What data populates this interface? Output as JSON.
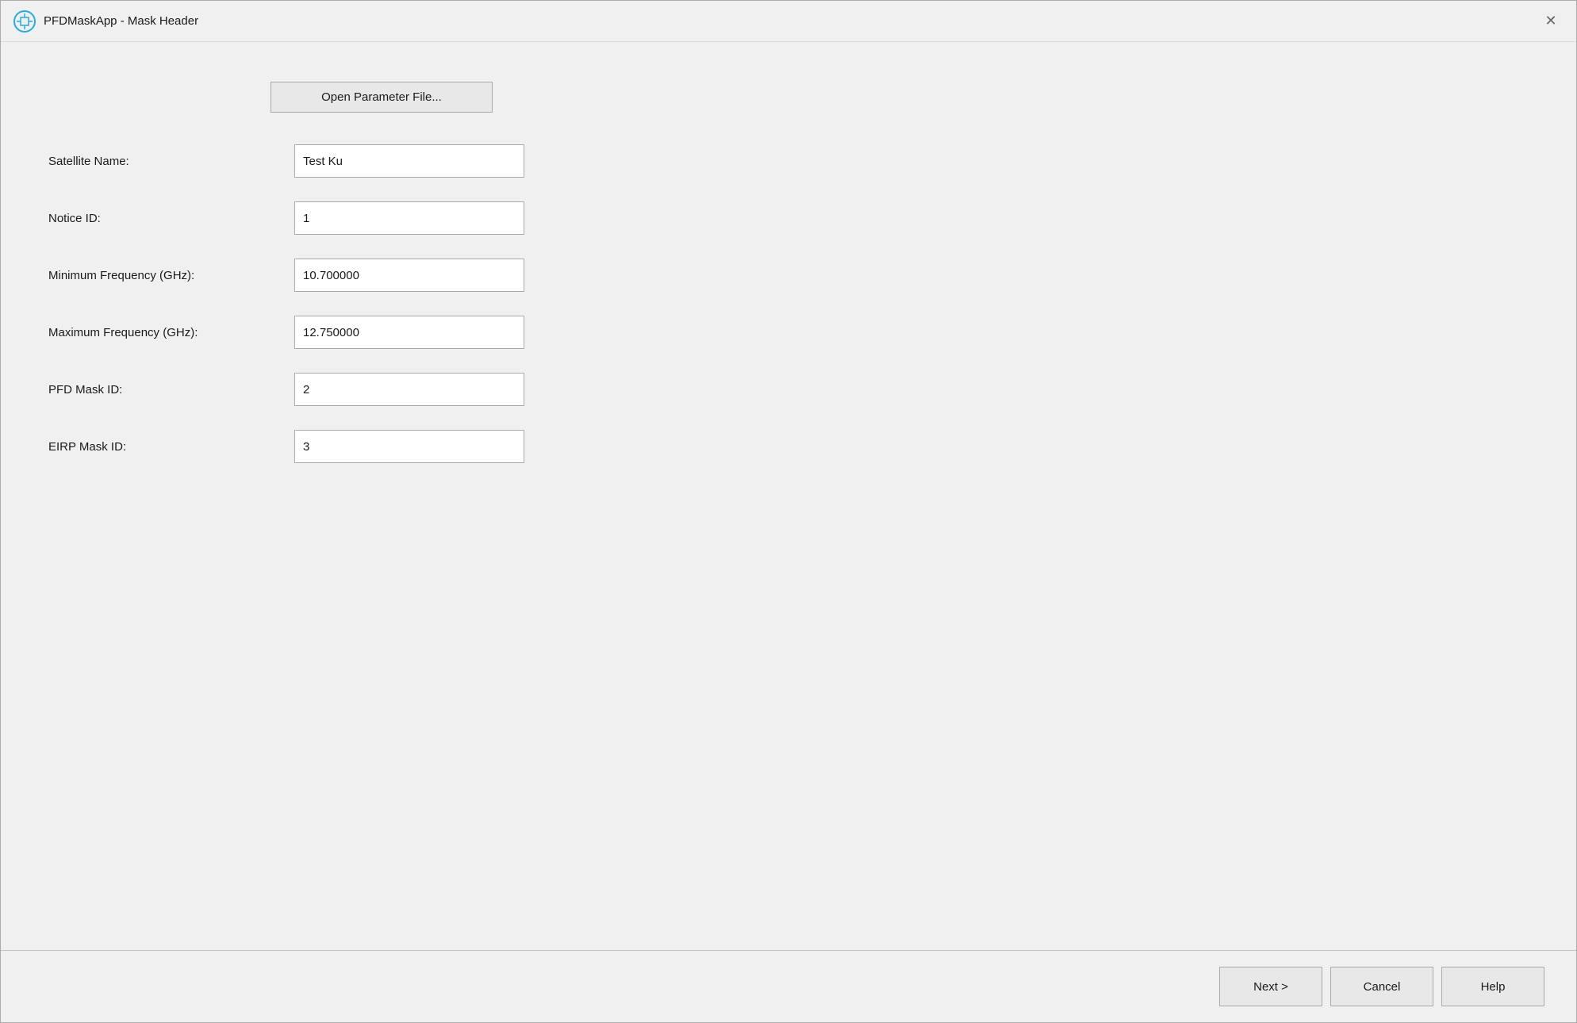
{
  "titleBar": {
    "title": "PFDMaskApp - Mask Header",
    "closeLabel": "✕"
  },
  "openParamButton": {
    "label": "Open Parameter File..."
  },
  "form": {
    "fields": [
      {
        "label": "Satellite Name:",
        "value": "Test Ku",
        "id": "satellite-name"
      },
      {
        "label": "Notice ID:",
        "value": "1",
        "id": "notice-id"
      },
      {
        "label": "Minimum Frequency (GHz):",
        "value": "10.700000",
        "id": "min-freq"
      },
      {
        "label": "Maximum Frequency (GHz):",
        "value": "12.750000",
        "id": "max-freq"
      },
      {
        "label": "PFD Mask ID:",
        "value": "2",
        "id": "pfd-mask-id"
      },
      {
        "label": "EIRP Mask ID:",
        "value": "3",
        "id": "eirp-mask-id"
      }
    ]
  },
  "footer": {
    "nextLabel": "Next >",
    "cancelLabel": "Cancel",
    "helpLabel": "Help"
  }
}
